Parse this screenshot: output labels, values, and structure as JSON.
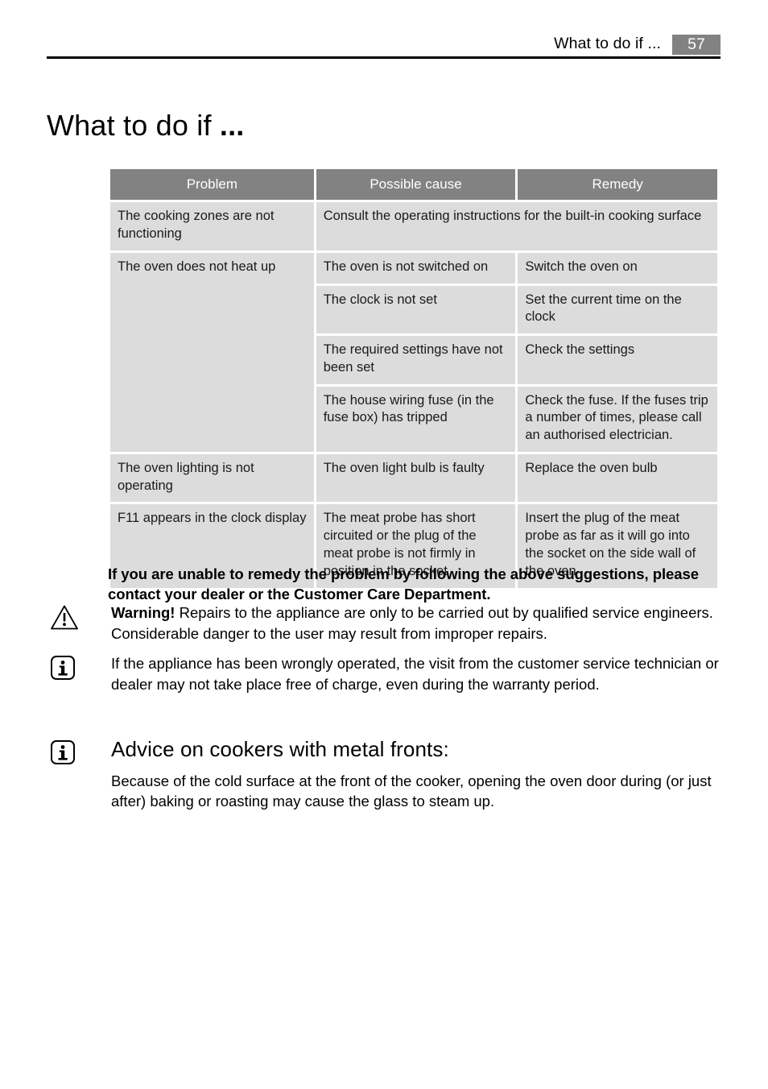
{
  "header": {
    "title": "What to do if ...",
    "page_number": "57",
    "page_number_bg": "#828282"
  },
  "chapter": {
    "title_main": "What to do if ",
    "title_ellipsis": "..."
  },
  "table": {
    "header_bg": "#828282",
    "cell_bg": "#dcdcdc",
    "columns": [
      "Problem",
      "Possible cause",
      "Remedy"
    ],
    "rows": [
      {
        "problem": "The cooking zones are not functioning",
        "cause": "Consult the operating instructions for the built-in cooking surface",
        "remedy": "",
        "cause_spans_remedy": true
      },
      {
        "problem": "The oven does not heat up",
        "cause": "The oven is not switched on",
        "remedy": "Switch the oven on"
      },
      {
        "problem": "",
        "cause": "The clock is not set",
        "remedy": "Set the current time on the clock"
      },
      {
        "problem": "",
        "cause": "The required settings have not been set",
        "remedy": "Check the settings"
      },
      {
        "problem": "",
        "cause": "The house wiring fuse (in the fuse box) has tripped",
        "remedy": "Check the fuse. If the fuses trip a number of times, please call an authorised electrician."
      },
      {
        "problem": "The oven lighting is not operating",
        "cause": "The oven light bulb is faulty",
        "remedy": "Replace the oven bulb"
      },
      {
        "problem": "F11 appears in the clock display",
        "cause": "The meat probe has short circuited or the plug of the meat probe is not firmly in position in the socket",
        "remedy": "Insert the plug of the meat probe as far as it will go into the socket on the side wall of the oven"
      }
    ]
  },
  "lead_paragraph": "If you are unable to remedy the problem by following the above suggestions, please contact your dealer or the Customer Care Department.",
  "notes": {
    "warning": {
      "icon": "warning-triangle-icon",
      "label": "Warning!",
      "text": " Repairs to the appliance are only to be carried out by qualified service engineers. Considerable danger to the user may result from improper repairs."
    },
    "info": {
      "icon": "info-icon",
      "text": "If the appliance has been wrongly operated, the visit from the customer service technician or dealer may not take place free of charge, even during the warranty period."
    },
    "advice": {
      "icon": "info-icon",
      "heading": "Advice on cookers with metal fronts:",
      "text": "Because of the cold surface at the front of the cooker, opening the oven door during (or just after) baking or roasting may cause the glass to steam up."
    }
  }
}
